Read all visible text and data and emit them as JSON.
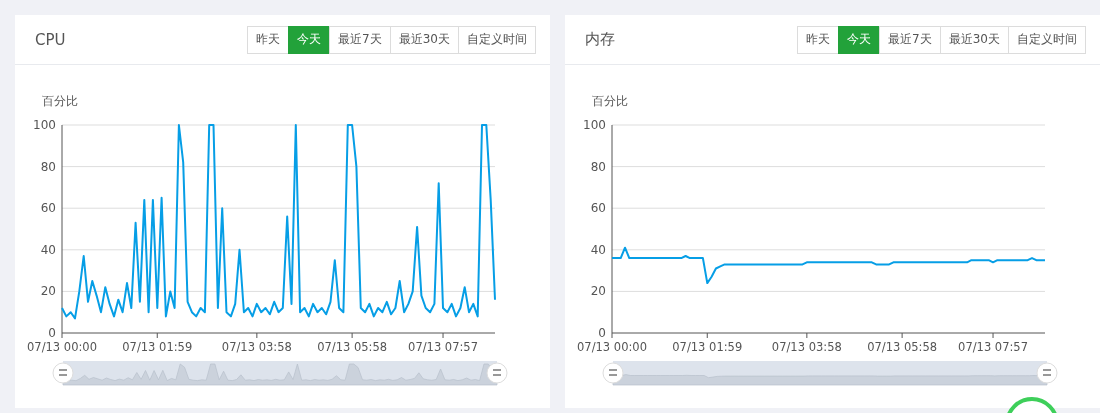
{
  "panels": [
    {
      "title": "CPU",
      "ranges": [
        {
          "label": "昨天",
          "selected": false
        },
        {
          "label": "今天",
          "selected": true
        },
        {
          "label": "最近7天",
          "selected": false
        },
        {
          "label": "最近30天",
          "selected": false
        },
        {
          "label": "自定义时间",
          "selected": false
        }
      ],
      "chart_data": {
        "type": "line",
        "ylabel": "百分比",
        "grid": true,
        "ylim": [
          0,
          100
        ],
        "yticks": [
          0,
          20,
          40,
          60,
          80,
          100
        ],
        "categories": [
          "07/13 00:00",
          null,
          null,
          null,
          null,
          null,
          null,
          null,
          null,
          null,
          null,
          null,
          null,
          null,
          null,
          null,
          null,
          null,
          null,
          null,
          null,
          null,
          "07/13 01:59",
          null,
          null,
          null,
          null,
          null,
          null,
          null,
          null,
          null,
          null,
          null,
          null,
          null,
          null,
          null,
          null,
          null,
          null,
          null,
          null,
          null,
          null,
          "07/13 03:58",
          null,
          null,
          null,
          null,
          null,
          null,
          null,
          null,
          null,
          null,
          null,
          null,
          null,
          null,
          null,
          null,
          null,
          null,
          null,
          null,
          null,
          "07/13 05:58",
          null,
          null,
          null,
          null,
          null,
          null,
          null,
          null,
          null,
          null,
          null,
          null,
          null,
          null,
          null,
          null,
          null,
          null,
          null,
          null,
          "07/13 07:57",
          null,
          null,
          null,
          null,
          null,
          null,
          null,
          null,
          null,
          null,
          null,
          null
        ],
        "series": [
          {
            "color": "#069ee6",
            "values": [
              12,
              8,
              10,
              7,
              20,
              37,
              15,
              25,
              18,
              10,
              22,
              14,
              8,
              16,
              10,
              24,
              12,
              53,
              15,
              64,
              10,
              64,
              12,
              65,
              8,
              20,
              12,
              100,
              82,
              15,
              10,
              8,
              12,
              10,
              100,
              100,
              12,
              60,
              10,
              8,
              14,
              40,
              10,
              12,
              8,
              14,
              10,
              12,
              9,
              15,
              10,
              12,
              56,
              14,
              100,
              10,
              12,
              8,
              14,
              10,
              12,
              9,
              15,
              35,
              12,
              10,
              100,
              100,
              80,
              12,
              10,
              14,
              8,
              12,
              10,
              15,
              9,
              12,
              25,
              10,
              14,
              20,
              51,
              18,
              12,
              10,
              14,
              72,
              12,
              10,
              14,
              8,
              12,
              22,
              10,
              14,
              8,
              100,
              100,
              64,
              16
            ]
          }
        ]
      }
    },
    {
      "title": "内存",
      "ranges": [
        {
          "label": "昨天",
          "selected": false
        },
        {
          "label": "今天",
          "selected": true
        },
        {
          "label": "最近7天",
          "selected": false
        },
        {
          "label": "最近30天",
          "selected": false
        },
        {
          "label": "自定义时间",
          "selected": false
        }
      ],
      "chart_data": {
        "type": "line",
        "ylabel": "百分比",
        "grid": true,
        "ylim": [
          0,
          100
        ],
        "yticks": [
          0,
          20,
          40,
          60,
          80,
          100
        ],
        "categories": [
          "07/13 00:00",
          null,
          null,
          null,
          null,
          null,
          null,
          null,
          null,
          null,
          null,
          null,
          null,
          null,
          null,
          null,
          null,
          null,
          null,
          null,
          null,
          null,
          "07/13 01:59",
          null,
          null,
          null,
          null,
          null,
          null,
          null,
          null,
          null,
          null,
          null,
          null,
          null,
          null,
          null,
          null,
          null,
          null,
          null,
          null,
          null,
          null,
          "07/13 03:58",
          null,
          null,
          null,
          null,
          null,
          null,
          null,
          null,
          null,
          null,
          null,
          null,
          null,
          null,
          null,
          null,
          null,
          null,
          null,
          null,
          null,
          "07/13 05:58",
          null,
          null,
          null,
          null,
          null,
          null,
          null,
          null,
          null,
          null,
          null,
          null,
          null,
          null,
          null,
          null,
          null,
          null,
          null,
          null,
          "07/13 07:57",
          null,
          null,
          null,
          null,
          null,
          null,
          null,
          null,
          null,
          null,
          null,
          null
        ],
        "series": [
          {
            "color": "#069ee6",
            "values": [
              36,
              36,
              36,
              41,
              36,
              36,
              36,
              36,
              36,
              36,
              36,
              36,
              36,
              36,
              36,
              36,
              36,
              37,
              36,
              36,
              36,
              36,
              24,
              27,
              31,
              32,
              33,
              33,
              33,
              33,
              33,
              33,
              33,
              33,
              33,
              33,
              33,
              33,
              33,
              33,
              33,
              33,
              33,
              33,
              33,
              34,
              34,
              34,
              34,
              34,
              34,
              34,
              34,
              34,
              34,
              34,
              34,
              34,
              34,
              34,
              34,
              33,
              33,
              33,
              33,
              34,
              34,
              34,
              34,
              34,
              34,
              34,
              34,
              34,
              34,
              34,
              34,
              34,
              34,
              34,
              34,
              34,
              34,
              35,
              35,
              35,
              35,
              35,
              34,
              35,
              35,
              35,
              35,
              35,
              35,
              35,
              35,
              36,
              35,
              35,
              35
            ]
          }
        ]
      }
    }
  ]
}
